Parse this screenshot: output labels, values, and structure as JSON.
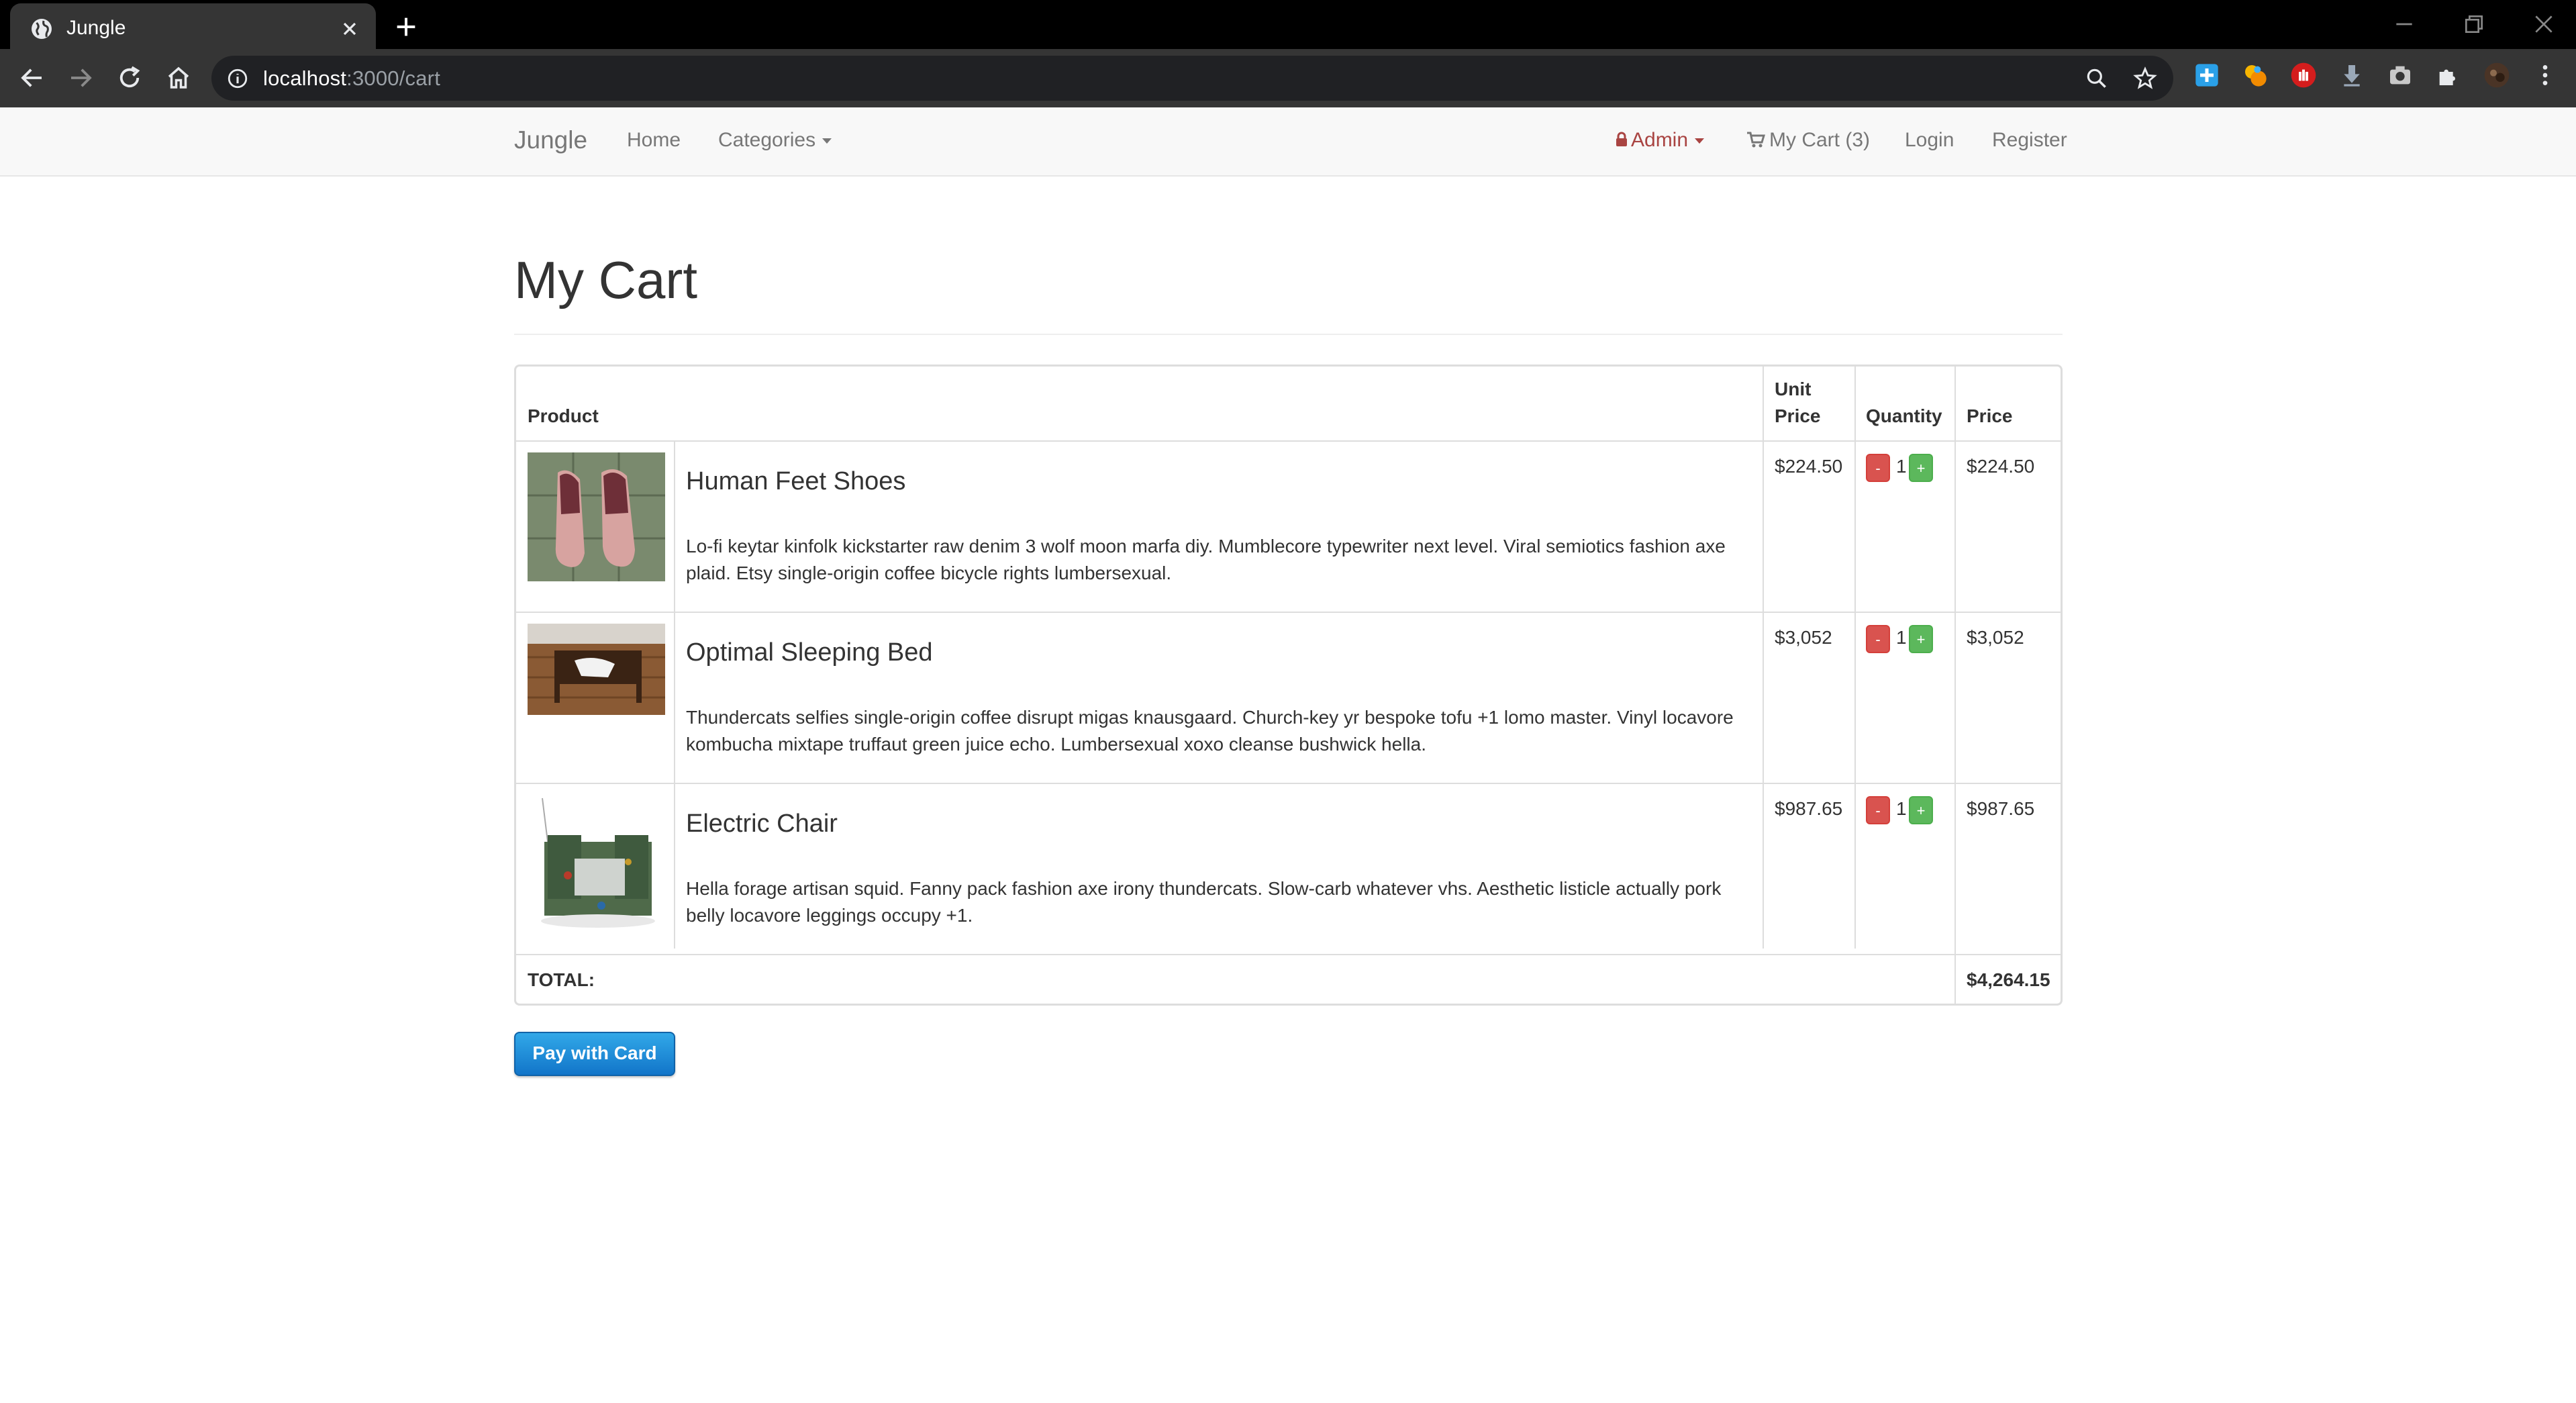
{
  "browser": {
    "tab_title": "Jungle",
    "url_host": "localhost",
    "url_path": ":3000/cart"
  },
  "navbar": {
    "brand": "Jungle",
    "home": "Home",
    "categories": "Categories",
    "admin": "Admin",
    "cart": "My Cart (3)",
    "login": "Login",
    "register": "Register"
  },
  "page": {
    "title": "My Cart"
  },
  "table": {
    "headers": {
      "product": "Product",
      "unit_price_1": "Unit",
      "unit_price_2": "Price",
      "quantity": "Quantity",
      "price": "Price"
    },
    "rows": [
      {
        "name": "Human Feet Shoes",
        "description": "Lo-fi keytar kinfolk kickstarter raw denim 3 wolf moon marfa diy. Mumblecore typewriter next level. Viral semiotics fashion axe plaid. Etsy single-origin coffee bicycle rights lumbersexual.",
        "unit_price": "$224.50",
        "quantity": "1",
        "price": "$224.50"
      },
      {
        "name": "Optimal Sleeping Bed",
        "description": "Thundercats selfies single-origin coffee disrupt migas knausgaard. Church-key yr bespoke tofu +1 lomo master. Vinyl locavore kombucha mixtape truffaut green juice echo. Lumbersexual xoxo cleanse bushwick hella.",
        "unit_price": "$3,052",
        "quantity": "1",
        "price": "$3,052"
      },
      {
        "name": "Electric Chair",
        "description": "Hella forage artisan squid. Fanny pack fashion axe irony thundercats. Slow-carb whatever vhs. Aesthetic listicle actually pork belly locavore leggings occupy +1.",
        "unit_price": "$987.65",
        "quantity": "1",
        "price": "$987.65"
      }
    ],
    "minus_label": "-",
    "plus_label": "+",
    "total_label": "TOTAL:",
    "total_value": "$4,264.15"
  },
  "pay_button": "Pay with Card",
  "colors": {
    "danger": "#d9534f",
    "success": "#5cb85c",
    "primary_button": "#1a8ad8",
    "admin_text": "#a94442"
  }
}
